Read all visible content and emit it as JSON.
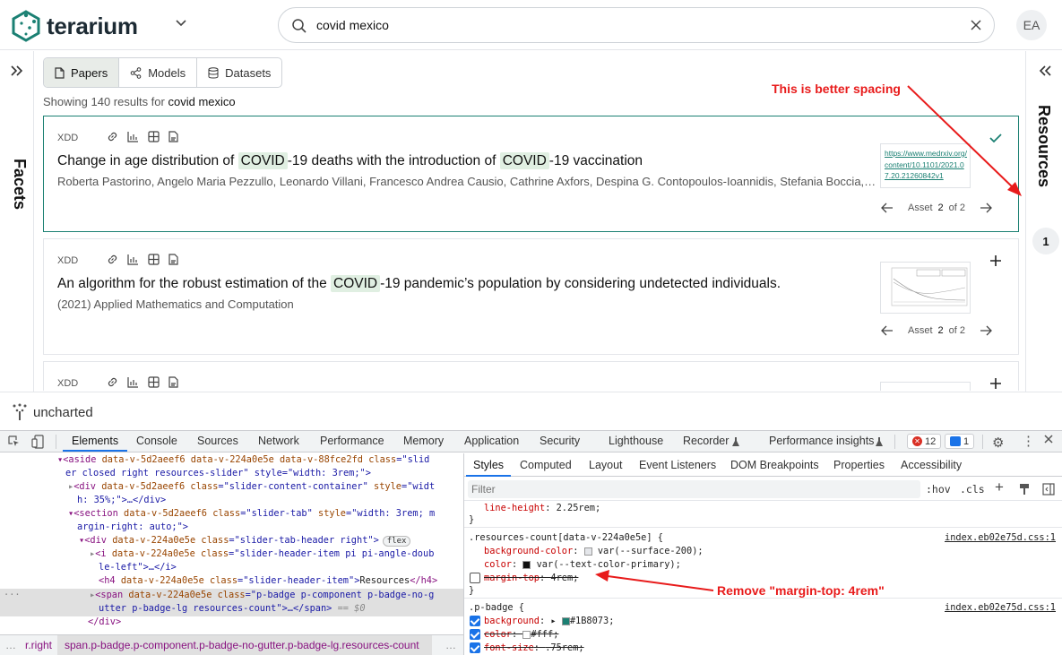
{
  "app": {
    "logo": "terarium",
    "search_value": "covid mexico",
    "avatar_initials": "EA"
  },
  "left_panel": {
    "label": "Facets"
  },
  "right_panel": {
    "label": "Resources",
    "count": "1"
  },
  "tabs": [
    {
      "label": "Papers",
      "icon": "document-icon",
      "active": true
    },
    {
      "label": "Models",
      "icon": "share-nodes-icon",
      "active": false
    },
    {
      "label": "Datasets",
      "icon": "database-icon",
      "active": false
    }
  ],
  "results": {
    "prefix": "Showing 140 results for",
    "query": "covid mexico",
    "cards": [
      {
        "source": "XDD",
        "title_parts": [
          "Change in age distribution of ",
          "COVID",
          "-19 deaths with the introduction of ",
          "COVID",
          "-19 vaccination"
        ],
        "subtitle": "Roberta Pastorino, Angelo Maria Pezzullo, Leonardo Villani, Francesco Andrea Causio, Cathrine Axfors, Despina G. Contopoulos-Ioannidis, Stefania Boccia, John P.A. Ioannidis",
        "link": "https://www.medrxiv.org/content/10.1101/2021.07.20.21260842v1",
        "asset_prefix": "Asset",
        "asset_current": "2",
        "asset_of": "of 2",
        "action_icon": "check-icon"
      },
      {
        "source": "XDD",
        "title_parts": [
          "An algorithm for the robust estimation of the ",
          "COVID",
          "-19 pandemic’s population by considering undetected individuals."
        ],
        "subtitle": "(2021) Applied Mathematics and Computation",
        "asset_prefix": "Asset",
        "asset_current": "2",
        "asset_of": "of 2",
        "action_icon": "plus-icon"
      },
      {
        "source": "XDD",
        "action_icon": "plus-icon"
      }
    ]
  },
  "footer": {
    "brand": "uncharted"
  },
  "annotations": {
    "spacing_note": "This is better spacing",
    "remove_note": "Remove \"margin-top: 4rem\""
  },
  "devtools": {
    "tabs": [
      "Elements",
      "Console",
      "Sources",
      "Network",
      "Performance",
      "Memory",
      "Application",
      "Security",
      "Lighthouse",
      "Recorder",
      "Performance insights"
    ],
    "error_count": "12",
    "message_count": "1",
    "dom_lines": [
      [
        "<aside ",
        "data-v-5d2aeef6 data-v-224a0e5e data-v-88fce2fd ",
        "class",
        "=\"slid"
      ],
      [
        "er closed right resources-slider\" style=\"width: 3rem;\">"
      ],
      [
        "<div ",
        "data-v-5d2aeef6 ",
        "class",
        "=\"slider-content-container\" ",
        "style",
        "=\"widt"
      ],
      [
        "h: 35%;\">…</div>"
      ],
      [
        "<section ",
        "data-v-5d2aeef6 ",
        "class",
        "=\"slider-tab\" ",
        "style",
        "=\"width: 3rem; m"
      ],
      [
        "argin-right: auto;\">"
      ],
      [
        "<div ",
        "data-v-224a0e5e ",
        "class",
        "=\"slider-tab-header right\">"
      ],
      [
        "<i ",
        "data-v-224a0e5e ",
        "class",
        "=\"slider-header-item pi pi-angle-doub"
      ],
      [
        "le-left\">…</i>"
      ],
      [
        "<h4 ",
        "data-v-224a0e5e ",
        "class",
        "=\"slider-header-item\">",
        "Resources",
        "</h4>"
      ],
      [
        "<span ",
        "data-v-224a0e5e ",
        "class",
        "=\"p-badge p-component p-badge-no-g"
      ],
      [
        "utter p-badge-lg resources-count\">…</span>",
        " == $0"
      ],
      [
        "</div>"
      ]
    ],
    "flex_badge": "flex",
    "breadcrumb": [
      "r.right",
      "span.p-badge.p-component.p-badge-no-gutter.p-badge-lg.resources-count"
    ],
    "styles_tabs": [
      "Styles",
      "Computed",
      "Layout",
      "Event Listeners",
      "DOM Breakpoints",
      "Properties",
      "Accessibility"
    ],
    "filter_placeholder": "Filter",
    "hov": ":hov",
    "cls": ".cls",
    "styles": {
      "line_height": "line-height",
      "line_height_val": "2.25rem;",
      "rule1_selector": ".resources-count[data-v-224a0e5e] {",
      "rule1_source": "index.eb02e75d.css:1",
      "bg_prop": "background-color",
      "bg_val": "var(--surface-200);",
      "color_prop": "color",
      "color_val": "var(--text-color-primary);",
      "margin_prop": "margin-top",
      "margin_val": "4rem;",
      "rule2_selector": ".p-badge {",
      "rule2_source": "index.eb02e75d.css:1",
      "bg2_prop": "background",
      "bg2_val": "#1B8073;",
      "color2_prop": "color",
      "color2_val": "#fff;",
      "font_prop": "font-size",
      "font_val": ".75rem;"
    }
  },
  "colors": {
    "accent": "#1b8073",
    "highlight": "#e0efe2",
    "annotation": "#e81b1b"
  }
}
